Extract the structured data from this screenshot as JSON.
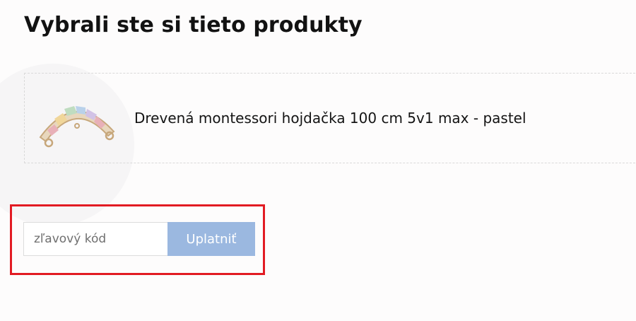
{
  "cart": {
    "title": "Vybrali ste si tieto produkty",
    "product": {
      "name": "Drevená montessori hojdačka 100 cm 5v1 max - pastel",
      "image_icon": "wooden-rocker-icon"
    }
  },
  "coupon": {
    "placeholder": "zľavový kód",
    "value": "",
    "apply_label": "Uplatniť"
  },
  "colors": {
    "highlight_border": "#e21b23",
    "button_bg": "#9bb8e0",
    "button_text": "#ffffff",
    "dashed_border": "#d9d9d9"
  }
}
